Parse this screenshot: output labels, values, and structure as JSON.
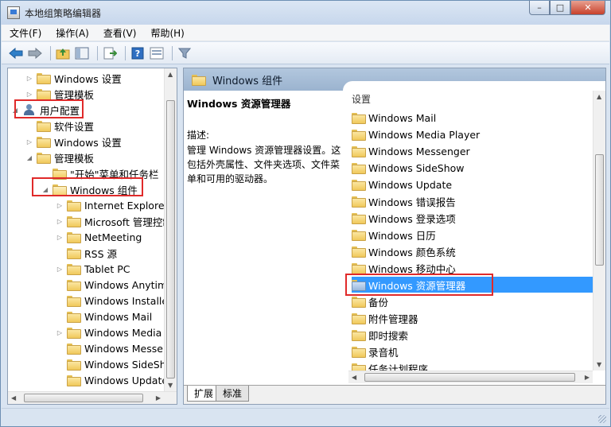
{
  "window": {
    "title": "本地组策略编辑器",
    "controls": {
      "minimize": "–",
      "maximize": "□",
      "close": "✕"
    }
  },
  "menu": [
    "文件(F)",
    "操作(A)",
    "查看(V)",
    "帮助(H)"
  ],
  "toolbar_icons": [
    "back-arrow-icon",
    "forward-arrow-icon",
    "up-folder-icon",
    "show-hide-tree-icon",
    "export-list-icon",
    "help-icon",
    "properties-icon",
    "filter-icon"
  ],
  "tree": [
    {
      "label": "Windows 设置",
      "level": 1,
      "expander": "▷",
      "icon": "folder"
    },
    {
      "label": "管理模板",
      "level": 1,
      "expander": "▷",
      "icon": "folder"
    },
    {
      "label": "用户配置",
      "level": 0,
      "expander": "◢",
      "icon": "user"
    },
    {
      "label": "软件设置",
      "level": 1,
      "expander": "",
      "icon": "folder"
    },
    {
      "label": "Windows 设置",
      "level": 1,
      "expander": "▷",
      "icon": "folder"
    },
    {
      "label": "管理模板",
      "level": 1,
      "expander": "◢",
      "icon": "folder"
    },
    {
      "label": "\"开始\"菜单和任务栏",
      "level": 2,
      "expander": "",
      "icon": "folder"
    },
    {
      "label": "Windows 组件",
      "level": 2,
      "expander": "◢",
      "icon": "folder-open"
    },
    {
      "label": "Internet Explorer",
      "level": 3,
      "expander": "▷",
      "icon": "folder"
    },
    {
      "label": "Microsoft 管理控制台",
      "level": 3,
      "expander": "▷",
      "icon": "folder"
    },
    {
      "label": "NetMeeting",
      "level": 3,
      "expander": "▷",
      "icon": "folder"
    },
    {
      "label": "RSS 源",
      "level": 3,
      "expander": "",
      "icon": "folder"
    },
    {
      "label": "Tablet PC",
      "level": 3,
      "expander": "▷",
      "icon": "folder"
    },
    {
      "label": "Windows Anytime Upgrade",
      "level": 3,
      "expander": "",
      "icon": "folder"
    },
    {
      "label": "Windows Installer",
      "level": 3,
      "expander": "",
      "icon": "folder"
    },
    {
      "label": "Windows Mail",
      "level": 3,
      "expander": "",
      "icon": "folder"
    },
    {
      "label": "Windows Media Player",
      "level": 3,
      "expander": "▷",
      "icon": "folder"
    },
    {
      "label": "Windows Messenger",
      "level": 3,
      "expander": "",
      "icon": "folder"
    },
    {
      "label": "Windows SideShow",
      "level": 3,
      "expander": "",
      "icon": "folder"
    },
    {
      "label": "Windows Update",
      "level": 3,
      "expander": "",
      "icon": "folder"
    }
  ],
  "detail": {
    "header": "Windows 组件",
    "title": "Windows 资源管理器",
    "desc_label": "描述:",
    "desc_text": "管理 Windows 资源管理器设置。这包括外壳属性、文件夹选项、文件菜单和可用的驱动器。",
    "list_header": "设置",
    "items": [
      "Windows Mail",
      "Windows Media Player",
      "Windows Messenger",
      "Windows SideShow",
      "Windows Update",
      "Windows 错误报告",
      "Windows 登录选项",
      "Windows 日历",
      "Windows 颜色系统",
      "Windows 移动中心",
      "Windows 资源管理器",
      "备份",
      "附件管理器",
      "即时搜索",
      "录音机",
      "任务计划程序"
    ],
    "selected": "Windows 资源管理器",
    "tabs": [
      "扩展",
      "标准"
    ],
    "active_tab": "扩展"
  },
  "colors": {
    "highlight": "#3399ff",
    "annotation": "#e02a2a",
    "header": "#a8bfd9"
  }
}
